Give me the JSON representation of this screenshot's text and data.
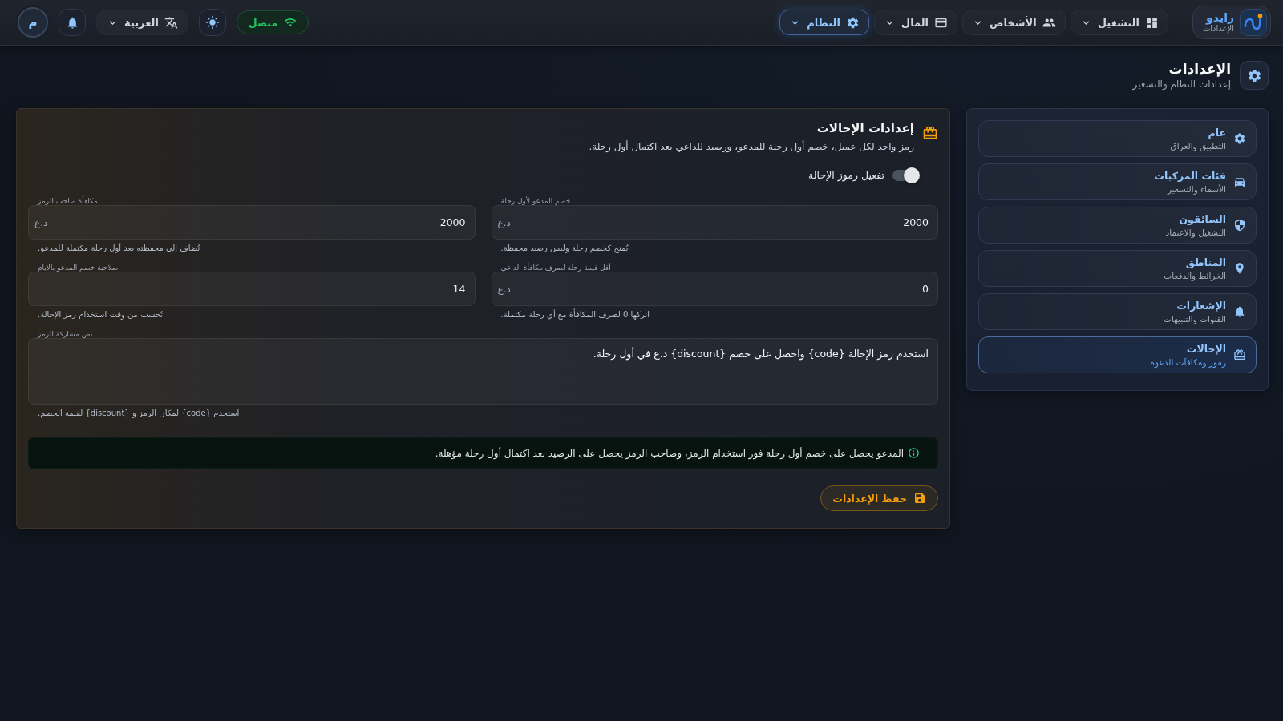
{
  "top_bar": {
    "brand": {
      "name": "رايدو",
      "subtitle": "الإعدادات"
    },
    "nav": [
      {
        "label": "التشغيل",
        "selected": false
      },
      {
        "label": "الأشخاص",
        "selected": false
      },
      {
        "label": "المال",
        "selected": false
      },
      {
        "label": "النظام",
        "selected": true
      }
    ],
    "status": {
      "label": "متصل"
    },
    "language": {
      "label": "العربية"
    },
    "avatar": {
      "initial": "م"
    }
  },
  "page_header": {
    "title": "الإعدادات",
    "subtitle": "إعدادات النظام والتسعير"
  },
  "sidebar": {
    "items": [
      {
        "title": "عام",
        "subtitle": "التطبيق والعراق",
        "selected": false
      },
      {
        "title": "فئات المركبات",
        "subtitle": "الأسماء والتسعير",
        "selected": false
      },
      {
        "title": "السائقون",
        "subtitle": "التشغيل والاعتماد",
        "selected": false
      },
      {
        "title": "المناطق",
        "subtitle": "الخرائط والدفعات",
        "selected": false
      },
      {
        "title": "الإشعارات",
        "subtitle": "القنوات والتنبيهات",
        "selected": false
      },
      {
        "title": "الإحالات",
        "subtitle": "رموز ومكافآت الدعوة",
        "selected": true
      }
    ]
  },
  "panel": {
    "title": "إعدادات الإحالات",
    "subtitle": "رمز واحد لكل عميل، خصم أول رحلة للمدعو، ورصيد للداعي بعد اكتمال أول رحلة.",
    "toggle": {
      "label": "تفعيل رموز الإحالة",
      "on": false
    },
    "fields": [
      {
        "label": "خصم المدعو لأول رحلة",
        "value": "2000",
        "suffix": "د.ع",
        "hint": "يُمنح كخصم رحلة وليس رصيد محفظة."
      },
      {
        "label": "مكافأة صاحب الرمز",
        "value": "2000",
        "suffix": "د.ع",
        "hint": "تُضاف إلى محفظته بعد أول رحلة مكتملة للمدعو."
      },
      {
        "label": "أقل قيمة رحلة لصرف مكافأة الداعي",
        "value": "0",
        "suffix": "د.ع",
        "hint": "اتركها 0 لصرف المكافأة مع أي رحلة مكتملة."
      },
      {
        "label": "صلاحية خصم المدعو بالأيام",
        "value": "14",
        "hint": "تُحسب من وقت استخدام رمز الإحالة."
      }
    ],
    "share_text": {
      "label": "نص مشاركة الرمز",
      "value": "استخدم رمز الإحالة {code} واحصل على خصم {discount} د.ع في أول رحلة.",
      "hint": "استخدم {code} لمكان الرمز و {discount} لقيمة الخصم."
    },
    "notice": "المدعو يحصل على خصم أول رحلة فور استخدام الرمز، وصاحب الرمز يحصل على الرصيد بعد اكتمال أول رحلة مؤهلة.",
    "save_button": "حفظ الإعدادات"
  }
}
